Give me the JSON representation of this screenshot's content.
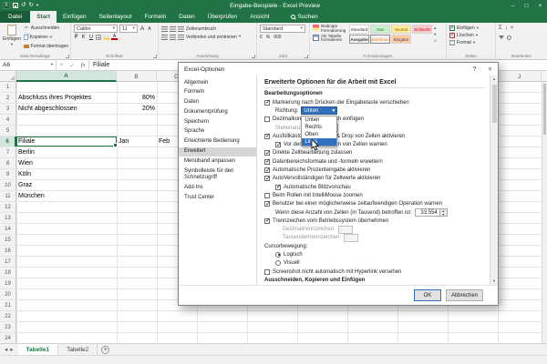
{
  "glyphs": {
    "chevron_down": "▾",
    "spin_up": "▴",
    "spin_down": "▾",
    "prev_sheet": "◂",
    "next_sheet": "▸",
    "add_sheet": "+",
    "sigma": "Σ",
    "undo": "↺",
    "redo": "↻",
    "min": "–",
    "max": "□",
    "close": "×",
    "menu": "≡",
    "app": "X",
    "fill_down": "↓",
    "clear": "×"
  },
  "window": {
    "title": "Eingabe-Beispiele - Excel Preview"
  },
  "ribbon": {
    "tabs": [
      {
        "label": "Datei",
        "file": true
      },
      {
        "label": "Start",
        "active": true
      },
      {
        "label": "Einfügen"
      },
      {
        "label": "Seitenlayout"
      },
      {
        "label": "Formeln"
      },
      {
        "label": "Daten"
      },
      {
        "label": "Überprüfen"
      },
      {
        "label": "Ansicht"
      }
    ],
    "search_label": "Suchen",
    "clipboard": {
      "paste_label": "Einfügen",
      "cut_label": "Ausschneiden",
      "copy_label": "Kopieren",
      "painter_label": "Format übertragen",
      "group_label": "Zwischenablage"
    },
    "font": {
      "family": "Calibri",
      "size": "11",
      "bold": "F",
      "italic": "K",
      "underline": "U",
      "color_letter": "A",
      "group_label": "Schriftart"
    },
    "alignment": {
      "wrap_label": "Zeilenumbruch",
      "merge_label": "Verbinden und zentrieren",
      "group_label": "Ausrichtung"
    },
    "number": {
      "format": "Standard",
      "currency_glyph": "€",
      "percent_glyph": "%",
      "thousands_glyph": "000",
      "group_label": "Zahl"
    },
    "styles": {
      "conditional_label": "Bedingte Formatierung",
      "table_label": "Als Tabelle formatieren",
      "group_label": "Formatvorlagen",
      "gallery": [
        {
          "label": "Standard",
          "variant": "normal"
        },
        {
          "label": "Gut",
          "variant": "good"
        },
        {
          "label": "Neutral",
          "variant": "neutral"
        },
        {
          "label": "Schlecht",
          "variant": "bad"
        },
        {
          "label": "Ausgabe",
          "variant": "output"
        },
        {
          "label": "Berechnung",
          "variant": "calc"
        },
        {
          "label": "Eingabe",
          "variant": "input"
        }
      ]
    },
    "cells": {
      "insert_label": "Einfügen",
      "delete_label": "Löschen",
      "format_label": "Format",
      "group_label": "Zellen"
    },
    "editing": {
      "group_label": "Bearbeiten"
    }
  },
  "formula_bar": {
    "name_box": "A6",
    "cancel_glyph": "×",
    "enter_glyph": "✓",
    "fx_glyph": "fx",
    "content": "Filiale"
  },
  "sheet": {
    "columns": [
      {
        "label": "A",
        "active": true
      },
      {
        "label": "B"
      },
      {
        "label": "C"
      },
      {
        "label": "D"
      },
      {
        "label": "E"
      },
      {
        "label": "F"
      },
      {
        "label": "G"
      },
      {
        "label": "H"
      },
      {
        "label": "I"
      },
      {
        "label": "J"
      }
    ],
    "rows": [
      {
        "n": "1",
        "cells": []
      },
      {
        "n": "2",
        "cells": [
          {
            "col": "A",
            "t": "Abschluss ihres Projektes"
          },
          {
            "col": "B",
            "t": "80%",
            "align": "r"
          }
        ]
      },
      {
        "n": "3",
        "cells": [
          {
            "col": "A",
            "t": "Nicht abgeschlossen"
          },
          {
            "col": "B",
            "t": "20%",
            "align": "r"
          }
        ]
      },
      {
        "n": "4",
        "cells": []
      },
      {
        "n": "5",
        "cells": []
      },
      {
        "n": "6",
        "active": true,
        "cells": [
          {
            "col": "A",
            "t": "Filiale",
            "sel": true
          },
          {
            "col": "B",
            "t": "Jan"
          },
          {
            "col": "C",
            "t": "Feb"
          }
        ]
      },
      {
        "n": "7",
        "cells": [
          {
            "col": "A",
            "t": "Berlin"
          }
        ]
      },
      {
        "n": "8",
        "cells": [
          {
            "col": "A",
            "t": "Wien"
          }
        ]
      },
      {
        "n": "9",
        "cells": [
          {
            "col": "A",
            "t": "Köln"
          }
        ]
      },
      {
        "n": "10",
        "cells": [
          {
            "col": "A",
            "t": "Graz"
          }
        ]
      },
      {
        "n": "11",
        "cells": [
          {
            "col": "A",
            "t": "München"
          }
        ]
      },
      {
        "n": "12",
        "cells": []
      },
      {
        "n": "13",
        "cells": []
      },
      {
        "n": "14",
        "cells": []
      },
      {
        "n": "15",
        "cells": []
      },
      {
        "n": "16",
        "cells": []
      },
      {
        "n": "17",
        "cells": []
      },
      {
        "n": "18",
        "cells": []
      },
      {
        "n": "19",
        "cells": []
      },
      {
        "n": "20",
        "cells": []
      },
      {
        "n": "21",
        "cells": []
      },
      {
        "n": "22",
        "cells": []
      },
      {
        "n": "23",
        "cells": []
      },
      {
        "n": "24",
        "cells": []
      }
    ]
  },
  "sheet_tabs": {
    "tabs": [
      {
        "label": "Tabelle1",
        "active": true
      },
      {
        "label": "Tabelle2"
      }
    ]
  },
  "dialog": {
    "title": "Excel-Optionen",
    "help_glyph": "?",
    "close_glyph": "×",
    "nav": [
      {
        "label": "Allgemein"
      },
      {
        "label": "Formeln"
      },
      {
        "label": "Daten"
      },
      {
        "label": "Dokumentprüfung"
      },
      {
        "label": "Speichern"
      },
      {
        "label": "Sprache"
      },
      {
        "label": "Erleichterte Bedienung"
      },
      {
        "label": "Erweitert",
        "active": true
      },
      {
        "label": "Menüband anpassen"
      },
      {
        "label": "Symbolleiste für den Schnellzugriff"
      },
      {
        "label": "Add-Ins"
      },
      {
        "label": "Trust Center"
      }
    ],
    "heading": "Erweiterte Optionen für die Arbeit mit Excel",
    "section_editing": "Bearbeitungsoptionen",
    "options": {
      "enter_move": {
        "checked": true,
        "label": "Markierung nach Drücken der Eingabetaste verschieben"
      },
      "direction": {
        "label": "Richtung:",
        "value": "Unten"
      },
      "decimal_auto": {
        "checked": false,
        "label": "Dezimalkomma automatisch einfügen"
      },
      "places": {
        "label": "Stellenanzahl:",
        "value": "2"
      },
      "fill_handle": {
        "checked": true,
        "label": "Ausfüllkästchen und Drag & Drop von Zellen aktivieren"
      },
      "overwrite_warn": {
        "checked": true,
        "label": "Vor dem Überschreiben von Zellen warnen"
      },
      "direct_edit": {
        "checked": true,
        "label": "Direkte Zellbearbeitung zulassen"
      },
      "extend_formats": {
        "checked": true,
        "label": "Datenbereichsformate und -formeln erweitern"
      },
      "percent_entry": {
        "checked": true,
        "label": "Automatische Prozenteingabe aktivieren"
      },
      "autocomplete": {
        "checked": true,
        "label": "AutoVervollständigen für Zellwerte aktivieren"
      },
      "flash_fill": {
        "checked": true,
        "label": "Automatische Blitzvorschau"
      },
      "intellimouse": {
        "checked": false,
        "label": "Beim Rollen mit IntelliMouse zoomen"
      },
      "long_op_warn": {
        "checked": true,
        "label": "Benutzer bei einer möglicherweise zeitaufwendigen Operation warnen"
      },
      "cells_threshold": {
        "label": "Wenn diese Anzahl von Zellen (in Tausend) betroffen ist:",
        "value": "33.554"
      },
      "system_separators": {
        "checked": true,
        "label": "Trennzeichen vom Betriebssystem übernehmen"
      },
      "decimal_sep": {
        "label": "Dezimaltrennzeichen:",
        "value": ","
      },
      "thousand_sep": {
        "label": "Tausendertrennzeichen:",
        "value": "."
      },
      "cursor_movement": {
        "label": "Cursorbewegung:"
      },
      "cursor_logical": {
        "checked": true,
        "label": "Logisch"
      },
      "cursor_visual": {
        "checked": false,
        "label": "Visuell"
      },
      "screenshot_link": {
        "checked": false,
        "label": "Screenshot nicht automatisch mit Hyperlink versehen"
      }
    },
    "dropdown": {
      "items": [
        {
          "label": "Unten"
        },
        {
          "label": "Rechts"
        },
        {
          "label": "Oben"
        },
        {
          "label": "Links",
          "hover": true
        }
      ]
    },
    "section_clipboard": "Ausschneiden, Kopieren und Einfügen",
    "ok_label": "OK",
    "cancel_label": "Abbrechen"
  }
}
